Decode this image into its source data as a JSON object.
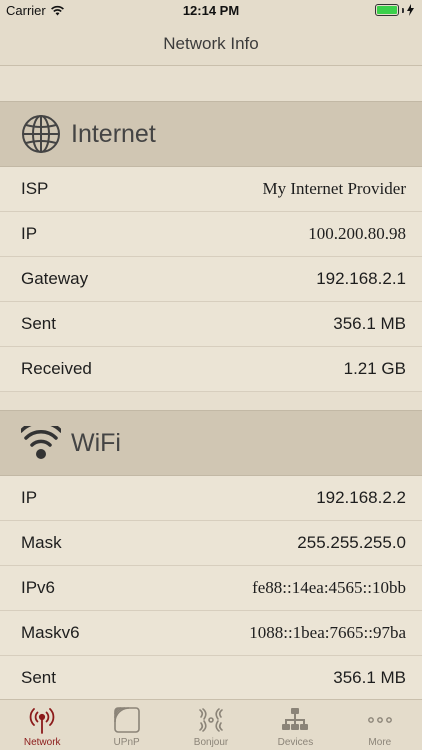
{
  "status_bar": {
    "carrier": "Carrier",
    "time": "12:14 PM",
    "battery_color": "#3bd04b"
  },
  "nav": {
    "title": "Network Info"
  },
  "internet": {
    "title": "Internet",
    "icon": "globe-icon",
    "rows": [
      {
        "label": "ISP",
        "value": "My Internet Provider"
      },
      {
        "label": "IP",
        "value": "100.200.80.98"
      },
      {
        "label": "Gateway",
        "value": "192.168.2.1"
      },
      {
        "label": "Sent",
        "value": "356.1 MB"
      },
      {
        "label": "Received",
        "value": "1.21 GB"
      }
    ]
  },
  "wifi": {
    "title": "WiFi",
    "icon": "wifi-icon",
    "rows": [
      {
        "label": "IP",
        "value": "192.168.2.2"
      },
      {
        "label": "Mask",
        "value": "255.255.255.0"
      },
      {
        "label": "IPv6",
        "value": "fe88::14ea:4565::10bb"
      },
      {
        "label": "Maskv6",
        "value": "1088::1bea:7665::97ba"
      },
      {
        "label": "Sent",
        "value": "356.1 MB"
      }
    ]
  },
  "tabs": [
    {
      "label": "Network",
      "icon": "antenna-icon",
      "active": true
    },
    {
      "label": "UPnP",
      "icon": "upnp-icon",
      "active": false
    },
    {
      "label": "Bonjour",
      "icon": "bonjour-icon",
      "active": false
    },
    {
      "label": "Devices",
      "icon": "devices-icon",
      "active": false
    },
    {
      "label": "More",
      "icon": "more-icon",
      "active": false
    }
  ],
  "colors": {
    "accent": "#8b1a1a",
    "background": "#e7dfcf",
    "section_header": "#d0c6b3"
  }
}
